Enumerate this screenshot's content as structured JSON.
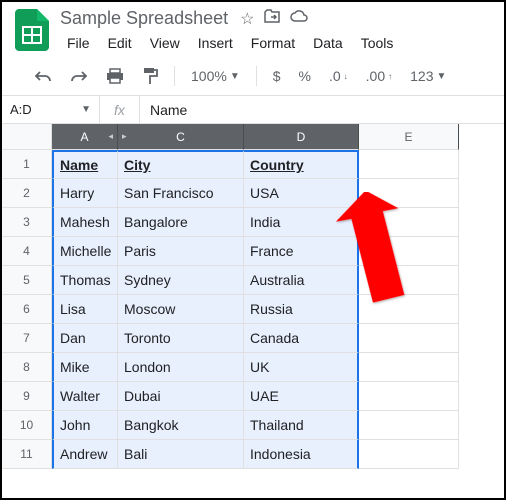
{
  "doc": {
    "title": "Sample Spreadsheet"
  },
  "menu": {
    "file": "File",
    "edit": "Edit",
    "view": "View",
    "insert": "Insert",
    "format": "Format",
    "data": "Data",
    "tools": "Tools"
  },
  "toolbar": {
    "zoom": "100%",
    "currency": "$",
    "percent": "%",
    "dec_dec": ".0",
    "dec_inc": ".00",
    "numfmt": "123"
  },
  "fxbar": {
    "range": "A:D",
    "value": "Name"
  },
  "columns": {
    "A": "A",
    "C": "C",
    "D": "D",
    "E": "E"
  },
  "rowlabels": [
    "1",
    "2",
    "3",
    "4",
    "5",
    "6",
    "7",
    "8",
    "9",
    "10",
    "11"
  ],
  "data": [
    {
      "a": "Name",
      "c": "City",
      "d": "Country"
    },
    {
      "a": "Harry",
      "c": "San Francisco",
      "d": "USA"
    },
    {
      "a": "Mahesh",
      "c": "Bangalore",
      "d": "India"
    },
    {
      "a": "Michelle",
      "c": "Paris",
      "d": "France"
    },
    {
      "a": "Thomas",
      "c": "Sydney",
      "d": "Australia"
    },
    {
      "a": "Lisa",
      "c": "Moscow",
      "d": "Russia"
    },
    {
      "a": "Dan",
      "c": "Toronto",
      "d": "Canada"
    },
    {
      "a": "Mike",
      "c": "London",
      "d": "UK"
    },
    {
      "a": "Walter",
      "c": "Dubai",
      "d": "UAE"
    },
    {
      "a": "John",
      "c": "Bangkok",
      "d": "Thailand"
    },
    {
      "a": "Andrew",
      "c": "Bali",
      "d": "Indonesia"
    }
  ]
}
